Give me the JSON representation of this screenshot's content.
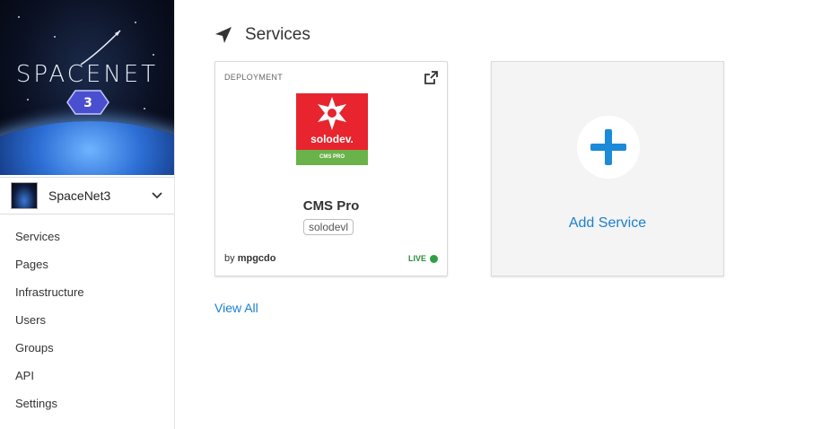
{
  "banner": {
    "title": "SPACENET",
    "badge_number": "3"
  },
  "project": {
    "name": "SpaceNet3"
  },
  "nav": {
    "items": [
      {
        "label": "Services"
      },
      {
        "label": "Pages"
      },
      {
        "label": "Infrastructure"
      },
      {
        "label": "Users"
      },
      {
        "label": "Groups"
      },
      {
        "label": "API"
      },
      {
        "label": "Settings"
      }
    ]
  },
  "page": {
    "title": "Services",
    "title_icon": "location-arrow-icon"
  },
  "service_card": {
    "kind": "DEPLOYMENT",
    "logo_brand": "solodev.",
    "logo_strip": "CMS PRO",
    "name": "CMS Pro",
    "tag": "solodevl",
    "by_prefix": "by",
    "owner": "mpgcdo",
    "status": "LIVE",
    "status_color": "#2ea043"
  },
  "add_service": {
    "label": "Add Service"
  },
  "view_all": {
    "label": "View All"
  },
  "colors": {
    "accent": "#1a7fd1",
    "solodev_red": "#e8242e",
    "solodev_green": "#6ab24a"
  }
}
